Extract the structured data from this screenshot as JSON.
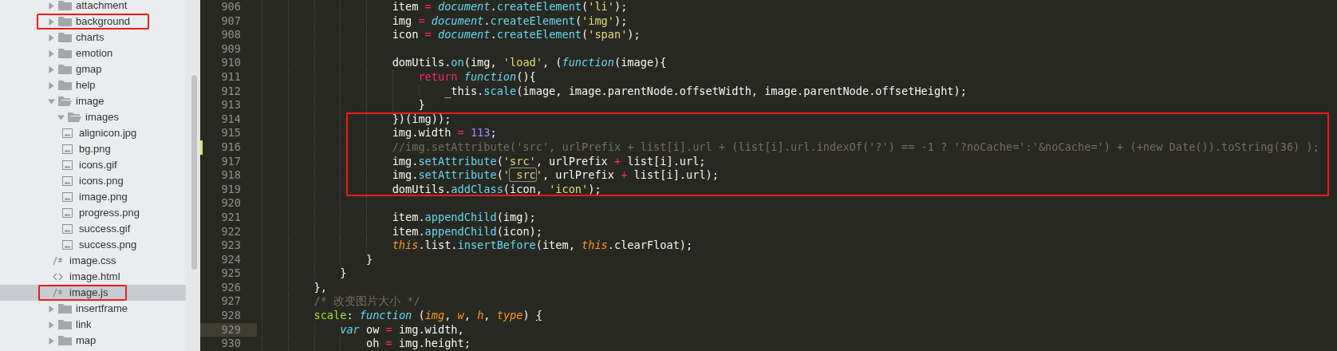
{
  "sidebar": {
    "items": [
      {
        "label": "attachment",
        "kind": "folder",
        "expanded": false,
        "selected": false,
        "highlighted": false
      },
      {
        "label": "background",
        "kind": "folder",
        "expanded": false,
        "selected": false,
        "highlighted": true
      },
      {
        "label": "charts",
        "kind": "folder",
        "expanded": false,
        "selected": false,
        "highlighted": false
      },
      {
        "label": "emotion",
        "kind": "folder",
        "expanded": false,
        "selected": false,
        "highlighted": false
      },
      {
        "label": "gmap",
        "kind": "folder",
        "expanded": false,
        "selected": false,
        "highlighted": false
      },
      {
        "label": "help",
        "kind": "folder",
        "expanded": false,
        "selected": false,
        "highlighted": false
      },
      {
        "label": "image",
        "kind": "folder",
        "expanded": true,
        "selected": false,
        "highlighted": false,
        "children": [
          {
            "label": "images",
            "kind": "folder",
            "expanded": true,
            "selected": false,
            "highlighted": false,
            "children": [
              {
                "label": "alignicon.jpg",
                "kind": "image-file",
                "selected": false,
                "highlighted": false
              },
              {
                "label": "bg.png",
                "kind": "image-file",
                "selected": false,
                "highlighted": false
              },
              {
                "label": "icons.gif",
                "kind": "image-file",
                "selected": false,
                "highlighted": false
              },
              {
                "label": "icons.png",
                "kind": "image-file",
                "selected": false,
                "highlighted": false
              },
              {
                "label": "image.png",
                "kind": "image-file",
                "selected": false,
                "highlighted": false
              },
              {
                "label": "progress.png",
                "kind": "image-file",
                "selected": false,
                "highlighted": false
              },
              {
                "label": "success.gif",
                "kind": "image-file",
                "selected": false,
                "highlighted": false
              },
              {
                "label": "success.png",
                "kind": "image-file",
                "selected": false,
                "highlighted": false
              }
            ]
          },
          {
            "label": "image.css",
            "kind": "code-file",
            "selected": false,
            "highlighted": false
          },
          {
            "label": "image.html",
            "kind": "markup-file",
            "selected": false,
            "highlighted": false
          },
          {
            "label": "image.js",
            "kind": "code-file",
            "selected": true,
            "highlighted": true
          }
        ]
      },
      {
        "label": "insertframe",
        "kind": "folder",
        "expanded": false,
        "selected": false,
        "highlighted": false
      },
      {
        "label": "link",
        "kind": "folder",
        "expanded": false,
        "selected": false,
        "highlighted": false
      },
      {
        "label": "map",
        "kind": "folder",
        "expanded": false,
        "selected": false,
        "highlighted": false
      }
    ]
  },
  "editor": {
    "lines": [
      {
        "number": "906",
        "boxed": false,
        "modified": false,
        "current": false,
        "tokens": [
          {
            "kind": "plain",
            "text": "                    item "
          },
          {
            "kind": "operator",
            "text": "="
          },
          {
            "kind": "storage",
            "text": " document"
          },
          {
            "kind": "plain",
            "text": "."
          },
          {
            "kind": "call",
            "text": "createElement"
          },
          {
            "kind": "plain",
            "text": "("
          },
          {
            "kind": "string",
            "text": "'li'"
          },
          {
            "kind": "plain",
            "text": ");"
          }
        ]
      },
      {
        "number": "907",
        "boxed": false,
        "modified": false,
        "current": false,
        "tokens": [
          {
            "kind": "plain",
            "text": "                    img "
          },
          {
            "kind": "operator",
            "text": "="
          },
          {
            "kind": "storage",
            "text": " document"
          },
          {
            "kind": "plain",
            "text": "."
          },
          {
            "kind": "call",
            "text": "createElement"
          },
          {
            "kind": "plain",
            "text": "("
          },
          {
            "kind": "string",
            "text": "'img'"
          },
          {
            "kind": "plain",
            "text": ");"
          }
        ]
      },
      {
        "number": "908",
        "boxed": false,
        "modified": false,
        "current": false,
        "tokens": [
          {
            "kind": "plain",
            "text": "                    icon "
          },
          {
            "kind": "operator",
            "text": "="
          },
          {
            "kind": "storage",
            "text": " document"
          },
          {
            "kind": "plain",
            "text": "."
          },
          {
            "kind": "call",
            "text": "createElement"
          },
          {
            "kind": "plain",
            "text": "("
          },
          {
            "kind": "string",
            "text": "'span'"
          },
          {
            "kind": "plain",
            "text": ");"
          }
        ]
      },
      {
        "number": "909",
        "boxed": false,
        "modified": false,
        "current": false
      },
      {
        "number": "910",
        "boxed": false,
        "modified": false,
        "current": false,
        "tokens": [
          {
            "kind": "plain",
            "text": "                    domUtils."
          },
          {
            "kind": "call",
            "text": "on"
          },
          {
            "kind": "plain",
            "text": "(img, "
          },
          {
            "kind": "string",
            "text": "'load'"
          },
          {
            "kind": "plain",
            "text": ", ("
          },
          {
            "kind": "storage",
            "text": "function"
          },
          {
            "kind": "plain",
            "text": "(image){"
          }
        ]
      },
      {
        "number": "911",
        "boxed": false,
        "modified": false,
        "current": false,
        "tokens": [
          {
            "kind": "keyword",
            "text": "                        return"
          },
          {
            "kind": "storage",
            "text": " function"
          },
          {
            "kind": "plain",
            "text": "(){"
          }
        ]
      },
      {
        "number": "912",
        "boxed": false,
        "modified": false,
        "current": false,
        "tokens": [
          {
            "kind": "plain",
            "text": "                            _this."
          },
          {
            "kind": "call",
            "text": "scale"
          },
          {
            "kind": "plain",
            "text": "(image, image.parentNode.offsetWidth, image.parentNode.offsetHeight);"
          }
        ]
      },
      {
        "number": "913",
        "boxed": false,
        "modified": false,
        "current": false,
        "tokens": [
          {
            "kind": "plain",
            "text": "                        }"
          }
        ]
      },
      {
        "number": "914",
        "boxed": true,
        "modified": false,
        "current": false,
        "tokens": [
          {
            "kind": "plain",
            "text": "                    })(img));"
          }
        ]
      },
      {
        "number": "915",
        "boxed": true,
        "modified": false,
        "current": false,
        "tokens": [
          {
            "kind": "plain",
            "text": "                    img.width "
          },
          {
            "kind": "operator",
            "text": "="
          },
          {
            "kind": "number",
            "text": " 113"
          },
          {
            "kind": "plain",
            "text": ";"
          }
        ]
      },
      {
        "number": "916",
        "boxed": true,
        "modified": true,
        "current": false,
        "tokens": [
          {
            "kind": "comment",
            "text": "                    //img.setAttribute('src', urlPrefix + list[i].url + (list[i].url.indexOf('?') == -1 ? '?noCache=':'&noCache=') + (+new Date()).toString(36) );"
          }
        ]
      },
      {
        "number": "917",
        "boxed": true,
        "modified": false,
        "current": false,
        "tokens": [
          {
            "kind": "plain",
            "text": "                    img."
          },
          {
            "kind": "call",
            "text": "setAttribute"
          },
          {
            "kind": "plain",
            "text": "("
          },
          {
            "kind": "string",
            "text": "'src'"
          },
          {
            "kind": "plain",
            "text": ", urlPrefix "
          },
          {
            "kind": "operator",
            "text": "+"
          },
          {
            "kind": "plain",
            "text": " list[i].url;"
          }
        ]
      },
      {
        "number": "918",
        "boxed": true,
        "modified": false,
        "current": false,
        "tokens": [
          {
            "kind": "plain",
            "text": "                    img."
          },
          {
            "kind": "call",
            "text": "setAttribute"
          },
          {
            "kind": "plain",
            "text": "("
          },
          {
            "kind": "string",
            "text": "'"
          },
          {
            "kind": "match",
            "text": "_src"
          },
          {
            "kind": "string",
            "text": "'"
          },
          {
            "kind": "plain",
            "text": ", urlPrefix "
          },
          {
            "kind": "operator",
            "text": "+"
          },
          {
            "kind": "plain",
            "text": " list[i].url);"
          }
        ]
      },
      {
        "number": "919",
        "boxed": true,
        "modified": false,
        "current": false,
        "tokens": [
          {
            "kind": "plain",
            "text": "                    domUtils."
          },
          {
            "kind": "call",
            "text": "addClass"
          },
          {
            "kind": "plain",
            "text": "(icon, "
          },
          {
            "kind": "string",
            "text": "'icon'"
          },
          {
            "kind": "plain",
            "text": ");"
          }
        ]
      },
      {
        "number": "920",
        "boxed": false,
        "modified": false,
        "current": false
      },
      {
        "number": "921",
        "boxed": false,
        "modified": false,
        "current": false,
        "tokens": [
          {
            "kind": "plain",
            "text": "                    item."
          },
          {
            "kind": "call",
            "text": "appendChild"
          },
          {
            "kind": "plain",
            "text": "(img);"
          }
        ]
      },
      {
        "number": "922",
        "boxed": false,
        "modified": false,
        "current": false,
        "tokens": [
          {
            "kind": "plain",
            "text": "                    item."
          },
          {
            "kind": "call",
            "text": "appendChild"
          },
          {
            "kind": "plain",
            "text": "(icon);"
          }
        ]
      },
      {
        "number": "923",
        "boxed": false,
        "modified": false,
        "current": false,
        "tokens": [
          {
            "kind": "this",
            "text": "                    this"
          },
          {
            "kind": "plain",
            "text": ".list."
          },
          {
            "kind": "call",
            "text": "insertBefore"
          },
          {
            "kind": "plain",
            "text": "(item, "
          },
          {
            "kind": "this",
            "text": "this"
          },
          {
            "kind": "plain",
            "text": ".clearFloat);"
          }
        ]
      },
      {
        "number": "924",
        "boxed": false,
        "modified": false,
        "current": false,
        "tokens": [
          {
            "kind": "plain",
            "text": "                }"
          }
        ]
      },
      {
        "number": "925",
        "boxed": false,
        "modified": false,
        "current": false,
        "tokens": [
          {
            "kind": "plain",
            "text": "            }"
          }
        ]
      },
      {
        "number": "926",
        "boxed": false,
        "modified": false,
        "current": false,
        "tokens": [
          {
            "kind": "plain",
            "text": "        },"
          }
        ]
      },
      {
        "number": "927",
        "boxed": false,
        "modified": false,
        "current": false,
        "tokens": [
          {
            "kind": "comment",
            "text": "        /* 改变图片大小 */"
          }
        ]
      },
      {
        "number": "928",
        "boxed": false,
        "modified": false,
        "current": false,
        "tokens": [
          {
            "kind": "key",
            "text": "        scale"
          },
          {
            "kind": "plain",
            "text": ": "
          },
          {
            "kind": "storage",
            "text": "function"
          },
          {
            "kind": "plain",
            "text": " ("
          },
          {
            "kind": "param",
            "text": "img"
          },
          {
            "kind": "plain",
            "text": ", "
          },
          {
            "kind": "param",
            "text": "w"
          },
          {
            "kind": "plain",
            "text": ", "
          },
          {
            "kind": "param",
            "text": "h"
          },
          {
            "kind": "plain",
            "text": ", "
          },
          {
            "kind": "param",
            "text": "type"
          },
          {
            "kind": "plain",
            "text": ") "
          },
          {
            "kind": "bracket",
            "text": "{"
          }
        ]
      },
      {
        "number": "929",
        "boxed": false,
        "modified": false,
        "current": true,
        "tokens": [
          {
            "kind": "storage",
            "text": "            var"
          },
          {
            "kind": "plain",
            "text": " ow "
          },
          {
            "kind": "operator",
            "text": "="
          },
          {
            "kind": "plain",
            "text": " img.width,"
          }
        ]
      },
      {
        "number": "930",
        "boxed": false,
        "modified": false,
        "current": false,
        "tokens": [
          {
            "kind": "plain",
            "text": "                oh "
          },
          {
            "kind": "operator",
            "text": "="
          },
          {
            "kind": "plain",
            "text": " img.height;"
          }
        ]
      }
    ]
  }
}
